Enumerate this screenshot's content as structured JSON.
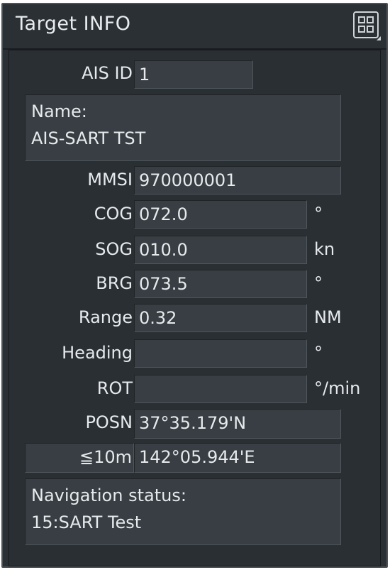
{
  "window": {
    "title": "Target INFO",
    "menu_icon": "grid-menu-icon"
  },
  "fields": {
    "ais_id": {
      "label": "AIS ID",
      "value": "1"
    },
    "name": {
      "label": "Name:",
      "value": "AIS-SART TST"
    },
    "mmsi": {
      "label": "MMSI",
      "value": "970000001"
    },
    "cog": {
      "label": "COG",
      "value": "072.0",
      "unit": "°"
    },
    "sog": {
      "label": "SOG",
      "value": "010.0",
      "unit": "kn"
    },
    "brg": {
      "label": "BRG",
      "value": "073.5",
      "unit": "°"
    },
    "range": {
      "label": "Range",
      "value": "0.32",
      "unit": "NM"
    },
    "heading": {
      "label": "Heading",
      "value": "",
      "unit": "°"
    },
    "rot": {
      "label": "ROT",
      "value": "",
      "unit": "°/min"
    },
    "posn": {
      "label": "POSN",
      "lat": "37°35.179'N"
    },
    "accuracy": {
      "label": "≦10m",
      "lon": "142°05.944'E"
    },
    "nav_status": {
      "label": "Navigation status:",
      "value": "15:SART Test"
    }
  }
}
